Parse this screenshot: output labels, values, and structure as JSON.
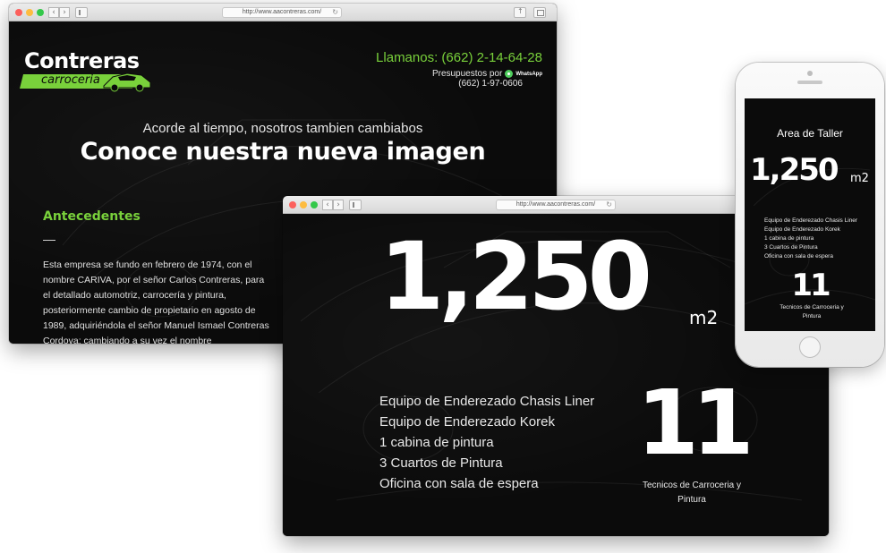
{
  "browser_main": {
    "url": "http://www.aacontreras.com/",
    "logo": {
      "name": "Contreras",
      "subtitle": "carroceria"
    },
    "contact": {
      "phone": "Llamanos: (662) 2-14-64-28",
      "quote_prefix": "Presupuestos por",
      "whatsapp_label": "WhatsApp",
      "whatsapp_number": "(662) 1-97-0606"
    },
    "tagline": "Acorde al tiempo, nosotros tambien cambiabos",
    "headline": "Conoce nuestra nueva imagen",
    "section_title": "Antecedentes",
    "body_text": "Esta empresa se fundo en febrero de 1974, con el nombre CARIVA, por el señor Carlos Contreras, para el detallado automotriz, carrocería y pintura, posteriormente cambio de propietario en agosto de 1989, adquiriéndola el señor Manuel Ismael Contreras Cordova; cambiando a su vez el nombre"
  },
  "browser_stats": {
    "url": "http://www.aacontreras.com/",
    "area_value": "1,250",
    "area_unit": "m2",
    "equipment": [
      "Equipo de Enderezado Chasis Liner",
      "Equipo de Enderezado Korek",
      "1 cabina de pintura",
      "3 Cuartos de Pintura",
      "Oficina con sala de espera"
    ],
    "technicians_value": "11",
    "technicians_label": "Tecnicos de Carroceria y Pintura"
  },
  "phone_screen": {
    "title": "Area de Taller",
    "area_value": "1,250",
    "area_unit": "m2",
    "equipment": [
      "Equipo de Enderezado Chasis Liner",
      "Equipo de Enderezado Korek",
      "1 cabina de pintura",
      "3 Cuartos de Pintura",
      "Oficina con sala de espera"
    ],
    "technicians_value": "11",
    "technicians_label": "Tecnicos de Carroceria y Pintura"
  },
  "colors": {
    "accent_green": "#79d13b",
    "page_background": "#0b0b0b",
    "whatsapp_green": "#4fce5d"
  }
}
